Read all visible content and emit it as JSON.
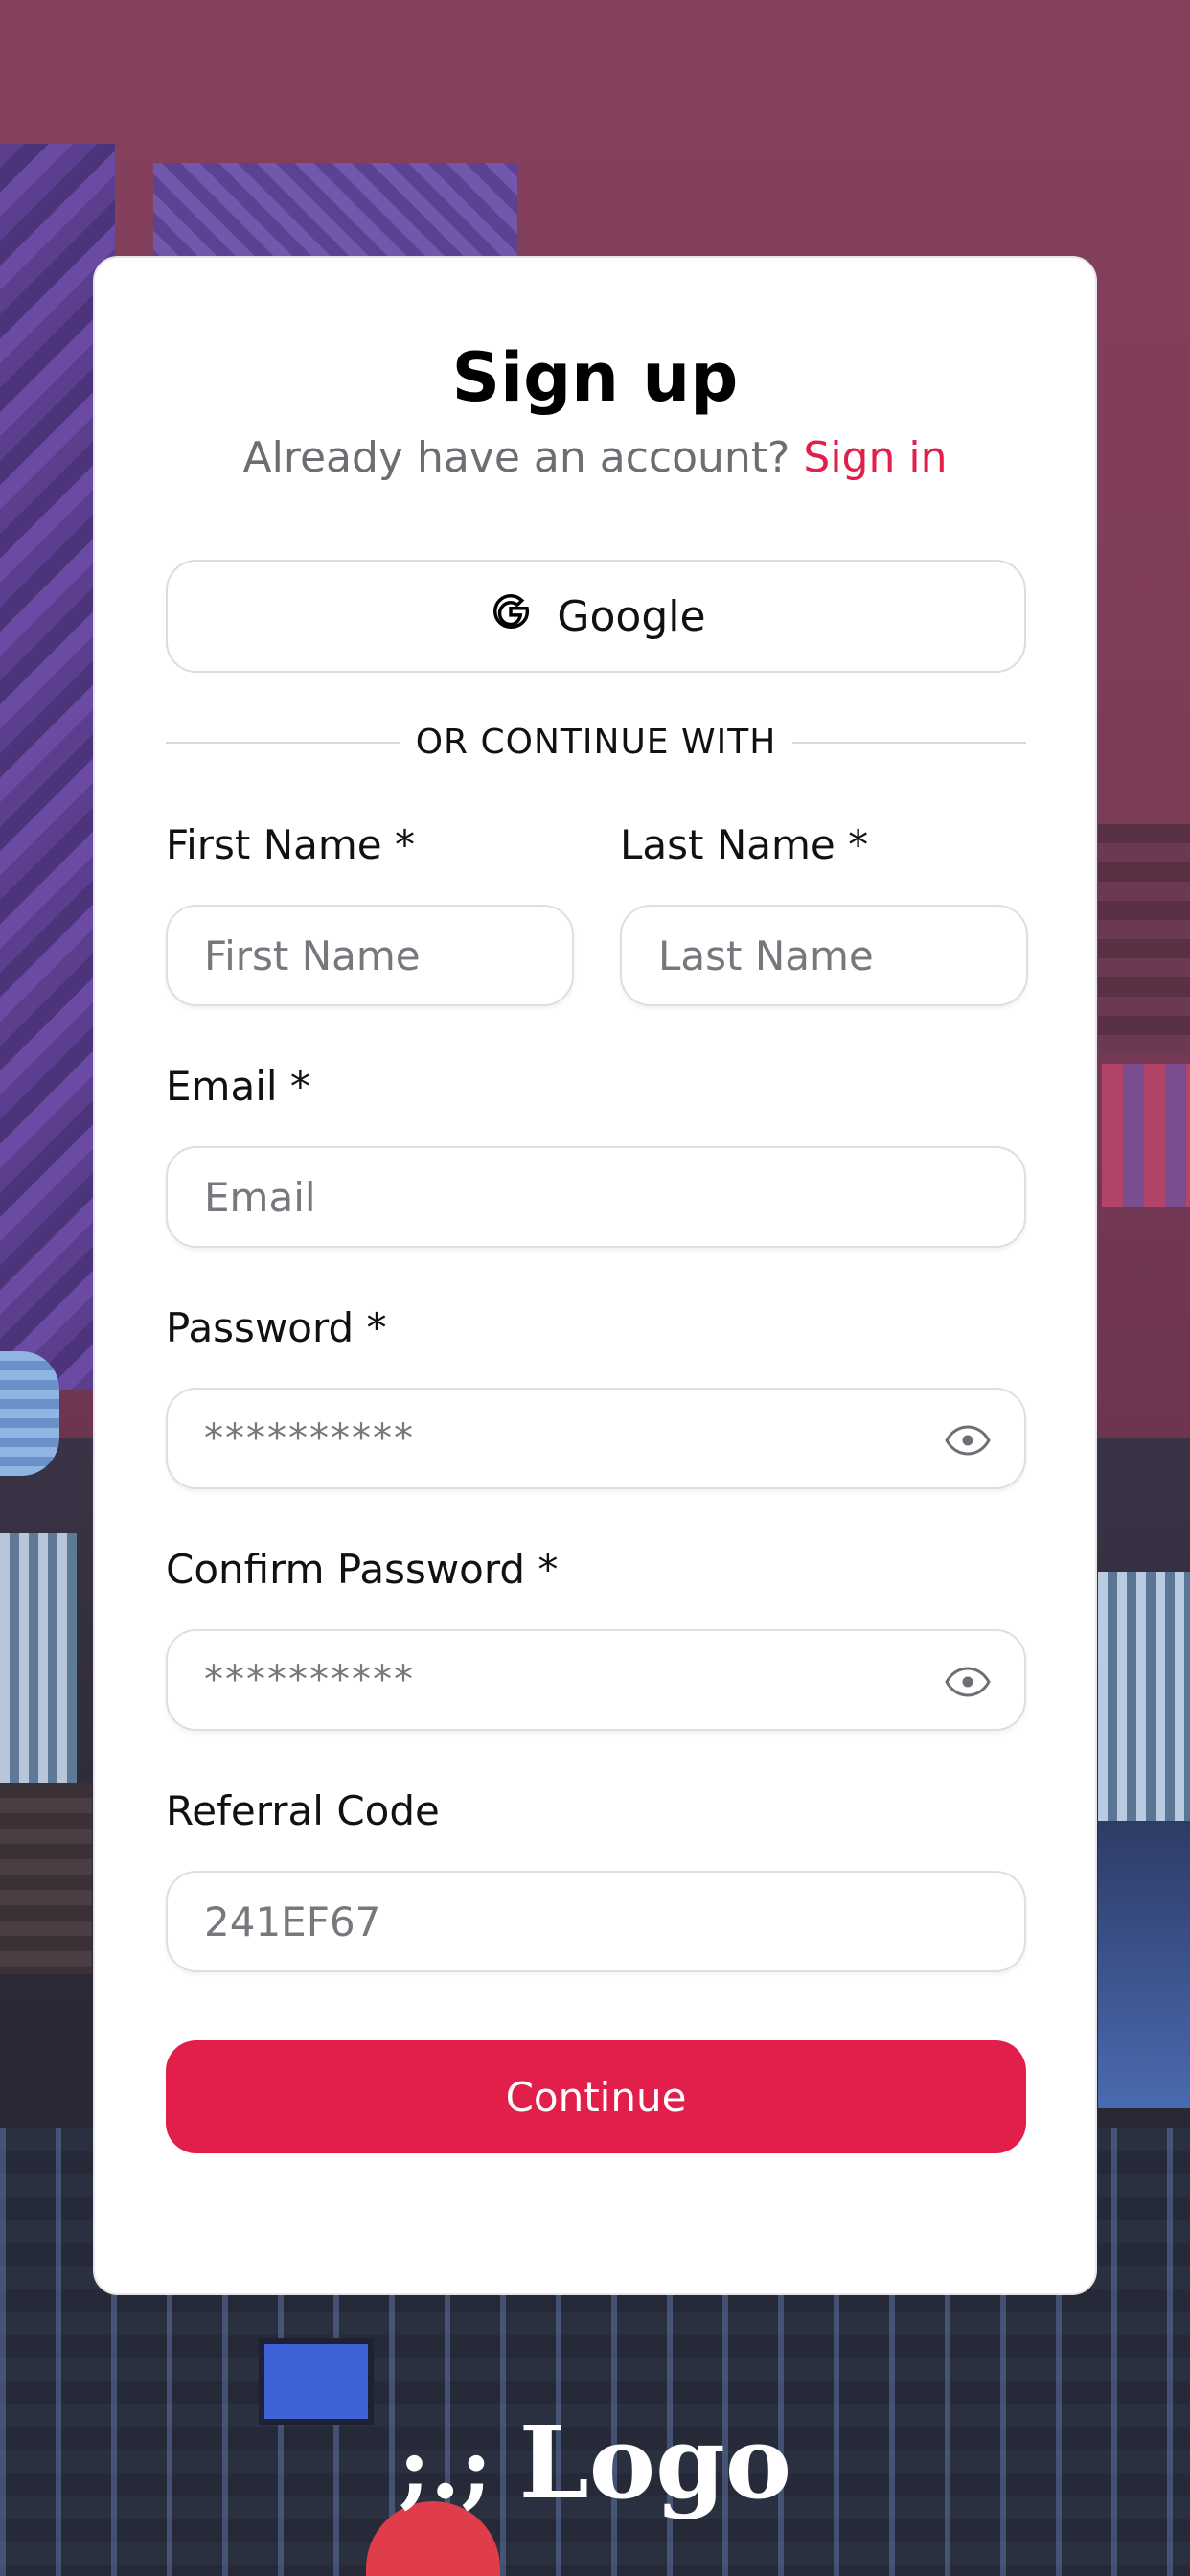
{
  "signup": {
    "title": "Sign up",
    "subtitle_prefix": "Already have an account?",
    "signin_link": "Sign in",
    "google_label": "Google",
    "divider_text": "OR CONTINUE WITH",
    "first_name": {
      "label": "First Name *",
      "placeholder": "First Name"
    },
    "last_name": {
      "label": "Last Name *",
      "placeholder": "Last Name"
    },
    "email": {
      "label": "Email *",
      "placeholder": "Email"
    },
    "password": {
      "label": "Password *",
      "placeholder": "**********"
    },
    "confirm_password": {
      "label": "Confirm Password *",
      "placeholder": "**********"
    },
    "referral": {
      "label": "Referral Code",
      "placeholder": "241EF67"
    },
    "continue_label": "Continue"
  },
  "logo": {
    "mark": ";.;",
    "text": "Logo"
  },
  "colors": {
    "accent": "#e21e4a",
    "background_sky": "#85405c",
    "card": "#ffffff"
  },
  "icons": [
    "google-icon",
    "eye-icon"
  ]
}
